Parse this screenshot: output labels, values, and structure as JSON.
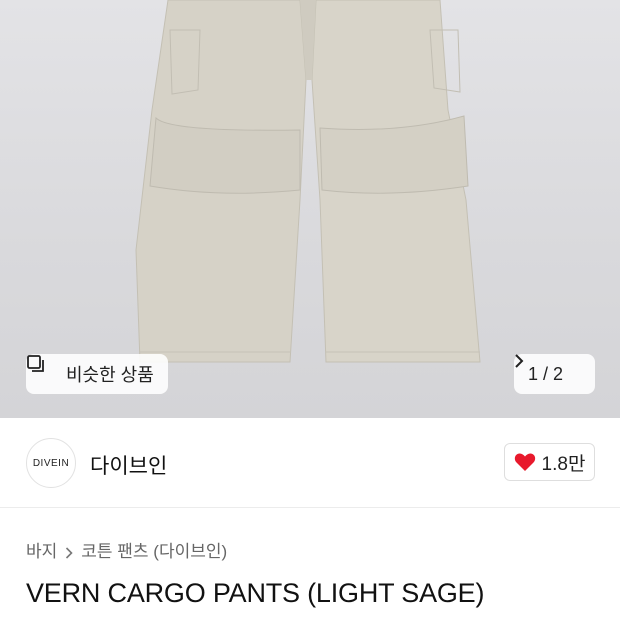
{
  "gallery": {
    "similar_label": "비슷한 상품",
    "pager": "1 / 2",
    "similar_icon": "similar-products-icon",
    "next_icon": "chevron-right-icon"
  },
  "brand": {
    "logo_text": "DIVEIN",
    "name": "다이브인"
  },
  "like": {
    "count": "1.8만",
    "icon": "heart-icon",
    "color": "#e8192c"
  },
  "breadcrumb": {
    "items": [
      "바지",
      "코튼 팬츠 (다이브인)"
    ]
  },
  "product": {
    "title": "VERN CARGO PANTS (LIGHT SAGE)"
  }
}
